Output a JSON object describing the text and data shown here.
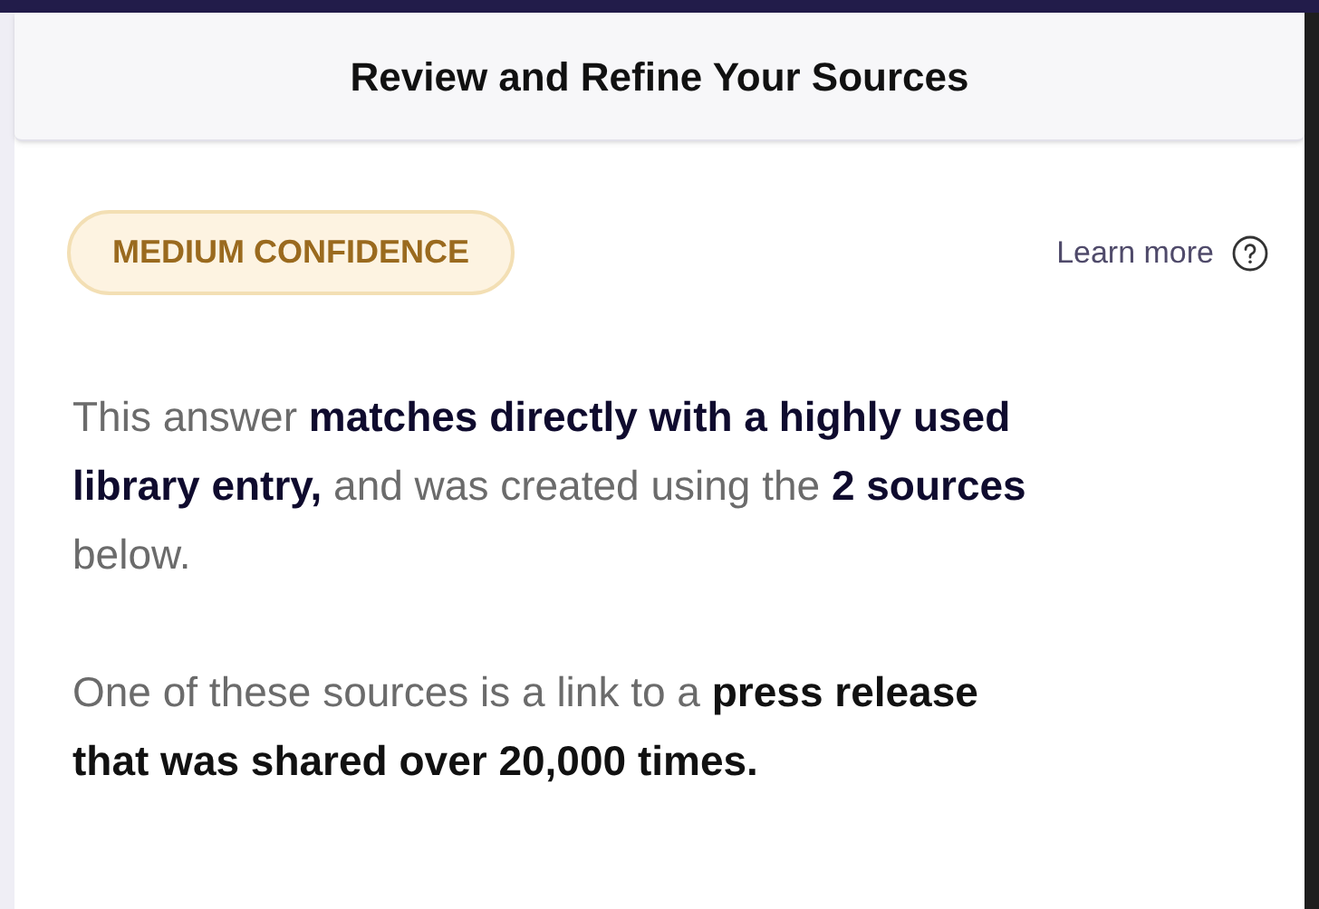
{
  "header": {
    "title": "Review and Refine Your Sources"
  },
  "confidence_badge": {
    "label": "MEDIUM CONFIDENCE"
  },
  "learn_more": {
    "label": "Learn more"
  },
  "paragraphs": [
    "This answer **matches directly with a highly used library entry,** and was created using the **2 sources** below.",
    "One of these sources is a link to a **press release that was shared over 20,000 times.**"
  ]
}
